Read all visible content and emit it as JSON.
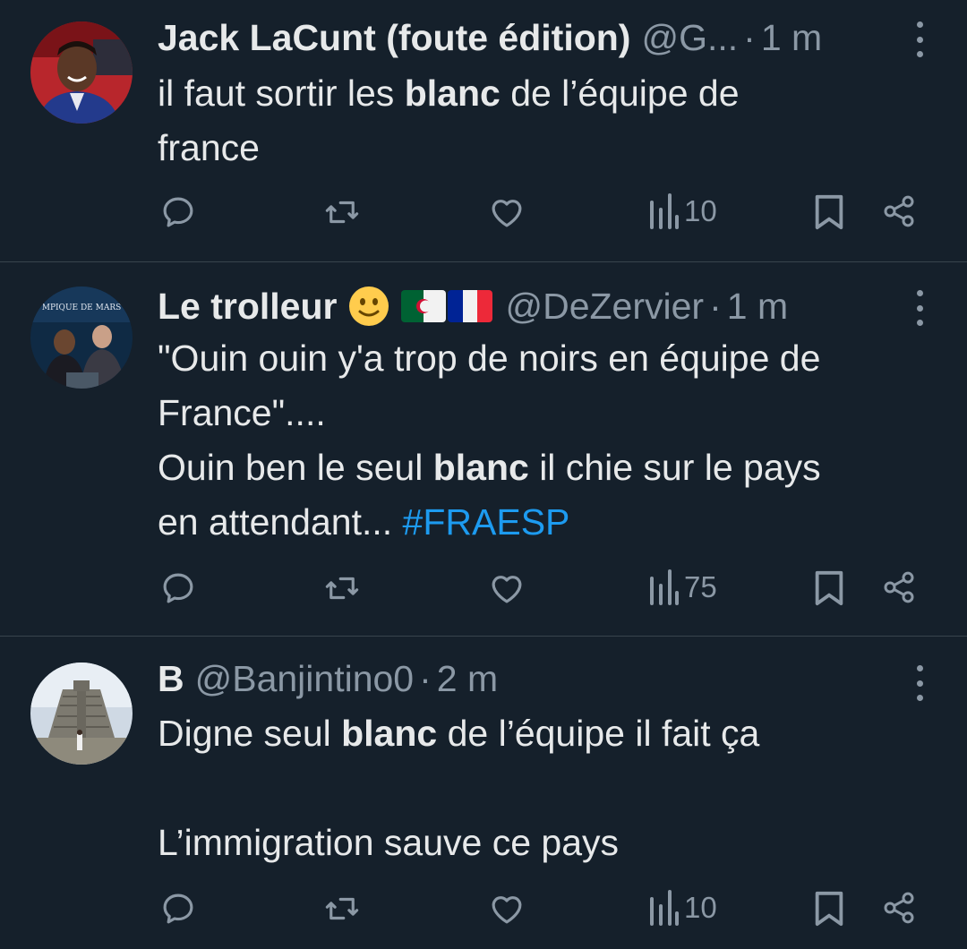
{
  "tweets": [
    {
      "name": "Jack LaCunt (foute édition)",
      "handle": "@G...",
      "dot": "·",
      "time": "1 m",
      "lines": [
        {
          "before": "il faut sortir les ",
          "bold": "blanc",
          "after": " de l’équipe de"
        },
        {
          "text": "france"
        }
      ],
      "views": "10"
    },
    {
      "name": "Le trolleur",
      "emojis": [
        "slightly-smiling-face",
        "flag-algeria",
        "flag-france"
      ],
      "handle": "@DeZervier",
      "dot": "·",
      "time": "1 m",
      "lines": [
        {
          "text": "\"Ouin ouin y'a trop de noirs en équipe de"
        },
        {
          "text": "France\"...."
        },
        {
          "before": "Ouin ben le seul ",
          "bold": "blanc",
          "after": " il chie sur le pays"
        },
        {
          "before": "en attendant... ",
          "hashtag": "#FRAESP"
        }
      ],
      "views": "75"
    },
    {
      "name": "B",
      "handle": "@Banjintino0",
      "dot": "·",
      "time": "2 m",
      "lines": [
        {
          "before": "Digne seul ",
          "bold": "blanc",
          "after": " de l’équipe il fait ça"
        },
        {
          "text": ""
        },
        {
          "text": "L’immigration sauve ce pays"
        }
      ],
      "views": "10"
    }
  ],
  "colors": {
    "background": "#15202b",
    "text": "#e7e9ea",
    "muted": "#8b98a5",
    "link": "#1d9bf0",
    "divider": "#38444d"
  },
  "icons": [
    "reply-icon",
    "retweet-icon",
    "like-icon",
    "views-icon",
    "bookmark-icon",
    "share-icon",
    "more-icon"
  ]
}
